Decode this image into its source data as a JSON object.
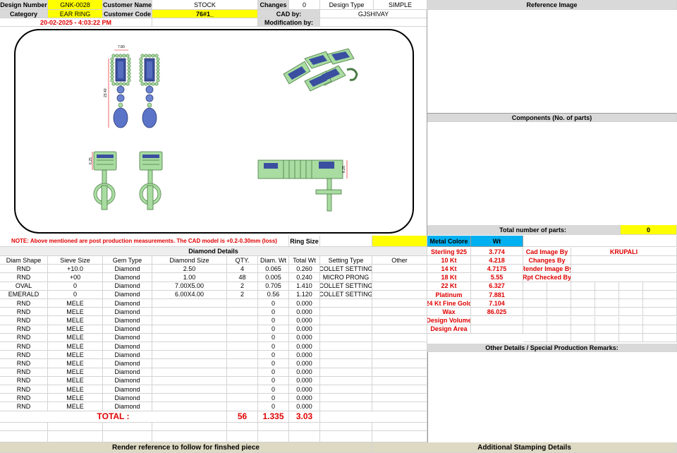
{
  "header": {
    "design_number_label": "Design Number",
    "design_number": "GNK-0028",
    "customer_name_label": "Customer Name",
    "customer_name": "STOCK",
    "changes_label": "Changes",
    "changes": "0",
    "design_type_label": "Design Type",
    "design_type": "SIMPLE",
    "reference_image_label": "Reference Image",
    "category_label": "Category",
    "category": "EAR RING",
    "customer_code_label": "Customer Code",
    "customer_code": "76#1_",
    "cad_by_label": "CAD by:",
    "cad_by": "GJSHIVAY",
    "datetime": "20-02-2025 - 4:03:22 PM",
    "modification_by_label": "Modification by:"
  },
  "cad": {
    "dim_width": "7.80",
    "dim_length": "23.40",
    "dim_side_a": "6.25",
    "dim_side_b": "6.25"
  },
  "note": "NOTE: Above mentioned are post production measurements. The CAD model is +0.2-0.30mm (loss)",
  "ring_size_label": "Ring Size",
  "components_label": "Components (No. of parts)",
  "total_parts_label": "Total number of parts:",
  "total_parts": "0",
  "diamond": {
    "title": "Diamond Details",
    "headers": [
      "Diam Shape",
      "Sieve Size",
      "Gem Type",
      "Diamond Size",
      "QTY.",
      "Diam. Wt",
      "Total Wt",
      "Setting Type",
      "Other"
    ],
    "rows": [
      [
        "RND",
        "+10.0",
        "Diamond",
        "2.50",
        "4",
        "0.065",
        "0.260",
        "COLLET SETTING",
        ""
      ],
      [
        "RND",
        "+00",
        "Diamond",
        "1.00",
        "48",
        "0.005",
        "0.240",
        "MICRO PRONG",
        ""
      ],
      [
        "OVAL",
        "0",
        "Diamond",
        "7.00X5.00",
        "2",
        "0.705",
        "1.410",
        "COLLET SETTING",
        ""
      ],
      [
        "EMERALD",
        "0",
        "Diamond",
        "6.00X4.00",
        "2",
        "0.56",
        "1.120",
        "COLLET SETTING",
        ""
      ],
      [
        "RND",
        "MELE",
        "Diamond",
        "",
        "",
        "0",
        "0.000",
        "",
        ""
      ],
      [
        "RND",
        "MELE",
        "Diamond",
        "",
        "",
        "0",
        "0.000",
        "",
        ""
      ],
      [
        "RND",
        "MELE",
        "Diamond",
        "",
        "",
        "0",
        "0.000",
        "",
        ""
      ],
      [
        "RND",
        "MELE",
        "Diamond",
        "",
        "",
        "0",
        "0.000",
        "",
        ""
      ],
      [
        "RND",
        "MELE",
        "Diamond",
        "",
        "",
        "0",
        "0.000",
        "",
        ""
      ],
      [
        "RND",
        "MELE",
        "Diamond",
        "",
        "",
        "0",
        "0.000",
        "",
        ""
      ],
      [
        "RND",
        "MELE",
        "Diamond",
        "",
        "",
        "0",
        "0.000",
        "",
        ""
      ],
      [
        "RND",
        "MELE",
        "Diamond",
        "",
        "",
        "0",
        "0.000",
        "",
        ""
      ],
      [
        "RND",
        "MELE",
        "Diamond",
        "",
        "",
        "0",
        "0.000",
        "",
        ""
      ],
      [
        "RND",
        "MELE",
        "Diamond",
        "",
        "",
        "0",
        "0.000",
        "",
        ""
      ],
      [
        "RND",
        "MELE",
        "Diamond",
        "",
        "",
        "0",
        "0.000",
        "",
        ""
      ],
      [
        "RND",
        "MELE",
        "Diamond",
        "",
        "",
        "0",
        "0.000",
        "",
        ""
      ],
      [
        "RND",
        "MELE",
        "Diamond",
        "",
        "",
        "0",
        "0.000",
        "",
        ""
      ]
    ],
    "total_label": "TOTAL :",
    "total_qty": "56",
    "total_diam_wt": "1.335",
    "total_wt": "3.03"
  },
  "metal": {
    "header_label": "Metal Colore",
    "header_wt": "Wt",
    "rows": [
      {
        "label": "Sterling 925",
        "wt": "3.774"
      },
      {
        "label": "10 Kt",
        "wt": "4.218"
      },
      {
        "label": "14 Kt",
        "wt": "4.7175"
      },
      {
        "label": "18 Kt",
        "wt": "5.55"
      },
      {
        "label": "22 Kt",
        "wt": "6.327"
      },
      {
        "label": "Platinum",
        "wt": "7.881"
      },
      {
        "label": "24 Kt Fine Gold",
        "wt": "7.104"
      },
      {
        "label": "Wax",
        "wt": "86.025"
      },
      {
        "label": "Design Volume",
        "wt": ""
      },
      {
        "label": "Design Area",
        "wt": ""
      }
    ]
  },
  "credits": [
    {
      "label": "Cad Image By",
      "value": "KRUPALI"
    },
    {
      "label": "Changes By",
      "value": ""
    },
    {
      "label": "Render Image By",
      "value": ""
    },
    {
      "label": "Rpt Checked By",
      "value": ""
    }
  ],
  "other_details_label": "Other Details / Special Production Remarks:",
  "footer": {
    "render_ref": "Render reference to follow for finshed piece",
    "stamping": "Additional Stamping Details"
  },
  "colors": {
    "metal": "#a8dca0",
    "stone": "#3a4fa0",
    "accent_red": "#e00000",
    "yellow": "#ffff00",
    "blue": "#00b0f0"
  }
}
